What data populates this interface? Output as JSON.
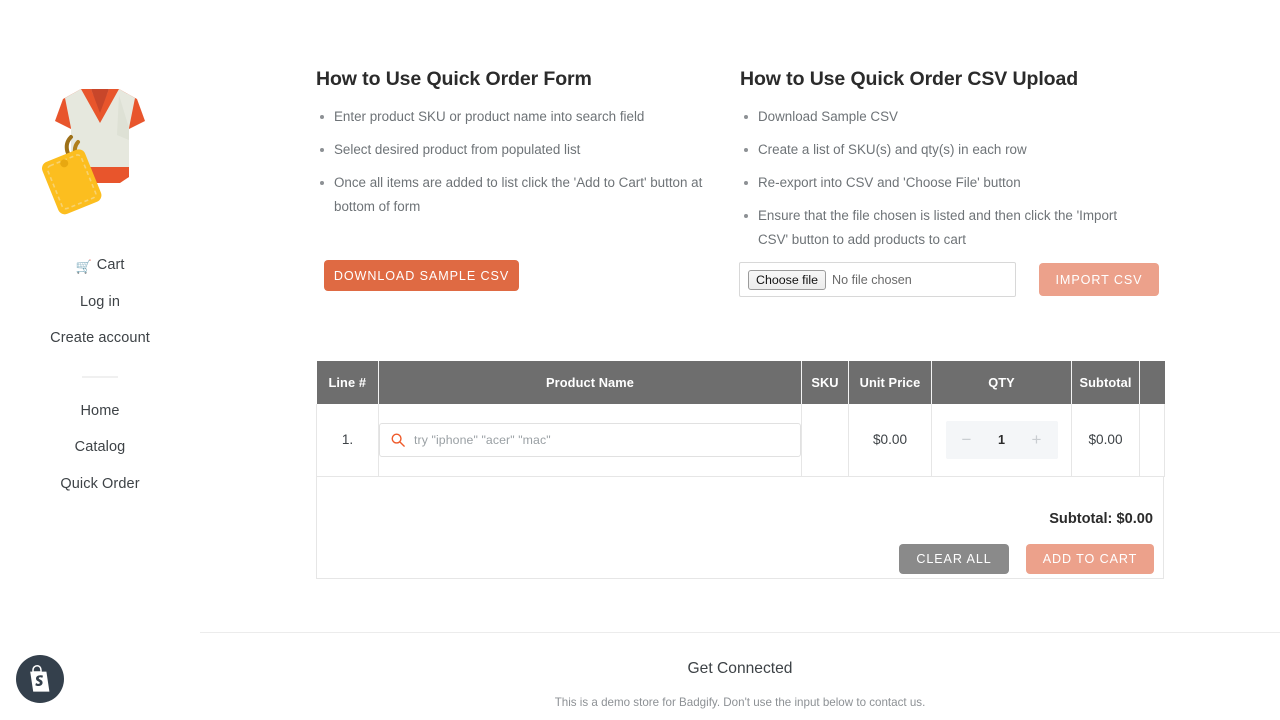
{
  "sidebar": {
    "logo_alt": "shirt-with-price-tag-logo",
    "items": [
      {
        "id": "cart",
        "label": "Cart",
        "icon": "shopping-cart-icon"
      },
      {
        "id": "log-in",
        "label": "Log in",
        "icon": ""
      },
      {
        "id": "create-account",
        "label": "Create account",
        "icon": ""
      },
      {
        "id": "home",
        "label": "Home",
        "icon": ""
      },
      {
        "id": "catalog",
        "label": "Catalog",
        "icon": ""
      },
      {
        "id": "quick-order",
        "label": "Quick Order",
        "icon": ""
      }
    ]
  },
  "instructions": {
    "form": {
      "title": "How to Use Quick Order Form",
      "steps": [
        "Enter product SKU or product name into search field",
        "Select desired product from populated list",
        "Once all items are added to list click the 'Add to Cart' button at bottom of form"
      ]
    },
    "csv": {
      "title": "How to Use Quick Order CSV Upload",
      "steps": [
        "Download Sample CSV",
        "Create a list of SKU(s) and qty(s) in each row",
        "Re-export into CSV and 'Choose File' button",
        "Ensure that the file chosen is listed and then click the 'Import CSV' button to add products to cart"
      ]
    }
  },
  "actions": {
    "download_sample_csv": "DOWNLOAD SAMPLE CSV",
    "import_csv": "IMPORT CSV",
    "clear_all": "CLEAR ALL",
    "add_to_cart": "ADD TO CART"
  },
  "file_upload": {
    "choose_file_label": "Choose file",
    "file_status": "No file chosen"
  },
  "order_table": {
    "columns": [
      "Line #",
      "Product Name",
      "SKU",
      "Unit Price",
      "QTY",
      "Subtotal",
      ""
    ],
    "rows": [
      {
        "line": "1.",
        "search_placeholder": "try \"iphone\" \"acer\" \"mac\"",
        "search_value": "",
        "sku": "",
        "unit_price": "$0.00",
        "qty": "1",
        "qty_decrease": "−",
        "qty_increase": "+",
        "subtotal": "$0.00",
        "remove": ""
      }
    ],
    "subtotal_label": "Subtotal: $0.00"
  },
  "footer": {
    "title": "Get Connected",
    "subtitle": "This is a demo store for Badgify. Don't use the input below to contact us."
  },
  "badge": {
    "name": "shopify-badge"
  },
  "colors": {
    "accent_orange": "#df6a43",
    "accent_salmon": "#eca18b",
    "table_header_gray": "#6e6e6e",
    "neutral_gray": "#8a8a8a",
    "search_icon_orange": "#ef5a2a"
  }
}
